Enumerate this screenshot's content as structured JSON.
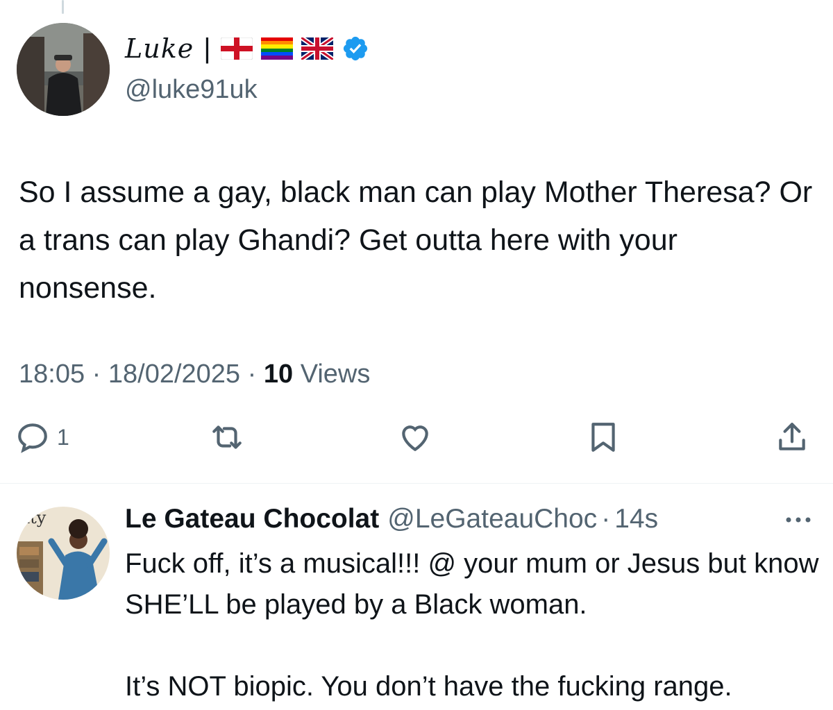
{
  "tweet": {
    "author": {
      "display_name": "Luke",
      "separator": "|",
      "flags": [
        "england-flag",
        "rainbow-flag",
        "uk-flag"
      ],
      "verified": true,
      "handle": "@luke91uk"
    },
    "text": "So I assume a gay, black man can play Mother Theresa? Or a trans can play Ghandi? Get outta here with your nonsense.",
    "time": "18:05",
    "date": "18/02/2025",
    "views_count": "10",
    "views_label": "Views",
    "meta_sep": "·",
    "actions": {
      "reply_count": "1",
      "icons": [
        "reply-icon",
        "retweet-icon",
        "like-icon",
        "bookmark-icon",
        "share-icon"
      ]
    }
  },
  "reply": {
    "display_name": "Le Gateau Chocolat",
    "handle": "@LeGateauChoc",
    "time": "14s",
    "sep": "·",
    "text": "Fuck off, it’s a musical!!! @ your mum or Jesus but know SHE’LL be played by a Black woman.\n\nIt’s NOT biopic. You don’t have the fucking range.",
    "avatar_text": "city"
  },
  "colors": {
    "text": "#0f1419",
    "secondary": "#536471",
    "verified": "#1d9bf0",
    "divider": "#eff3f4"
  }
}
